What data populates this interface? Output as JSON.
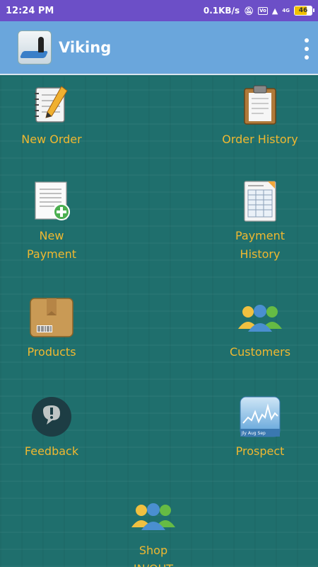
{
  "status_bar": {
    "time": "12:24 PM",
    "speed": "0.1KB/s",
    "battery": "46",
    "net_label": "4G"
  },
  "app_bar": {
    "title": "Viking"
  },
  "tiles": [
    {
      "label": "New Order",
      "icon": "notepad-pencil-icon"
    },
    {
      "label": "Order History",
      "icon": "clipboard-icon"
    },
    {
      "label": "New\nPayment",
      "icon": "document-add-icon"
    },
    {
      "label": "Payment\nHistory",
      "icon": "spreadsheet-icon"
    },
    {
      "label": "Products",
      "icon": "box-icon"
    },
    {
      "label": "Customers",
      "icon": "people-icon"
    },
    {
      "label": "Feedback",
      "icon": "feedback-bubble-icon"
    },
    {
      "label": "Prospect",
      "icon": "stocks-chart-icon"
    },
    {
      "label": "Shop\nIN/OUT",
      "icon": "people-icon"
    }
  ],
  "colors": {
    "status_bar": "#6c4fc7",
    "app_bar": "#6aa6dc",
    "background": "#1d6b6a",
    "tile_text": "#f0b830"
  }
}
